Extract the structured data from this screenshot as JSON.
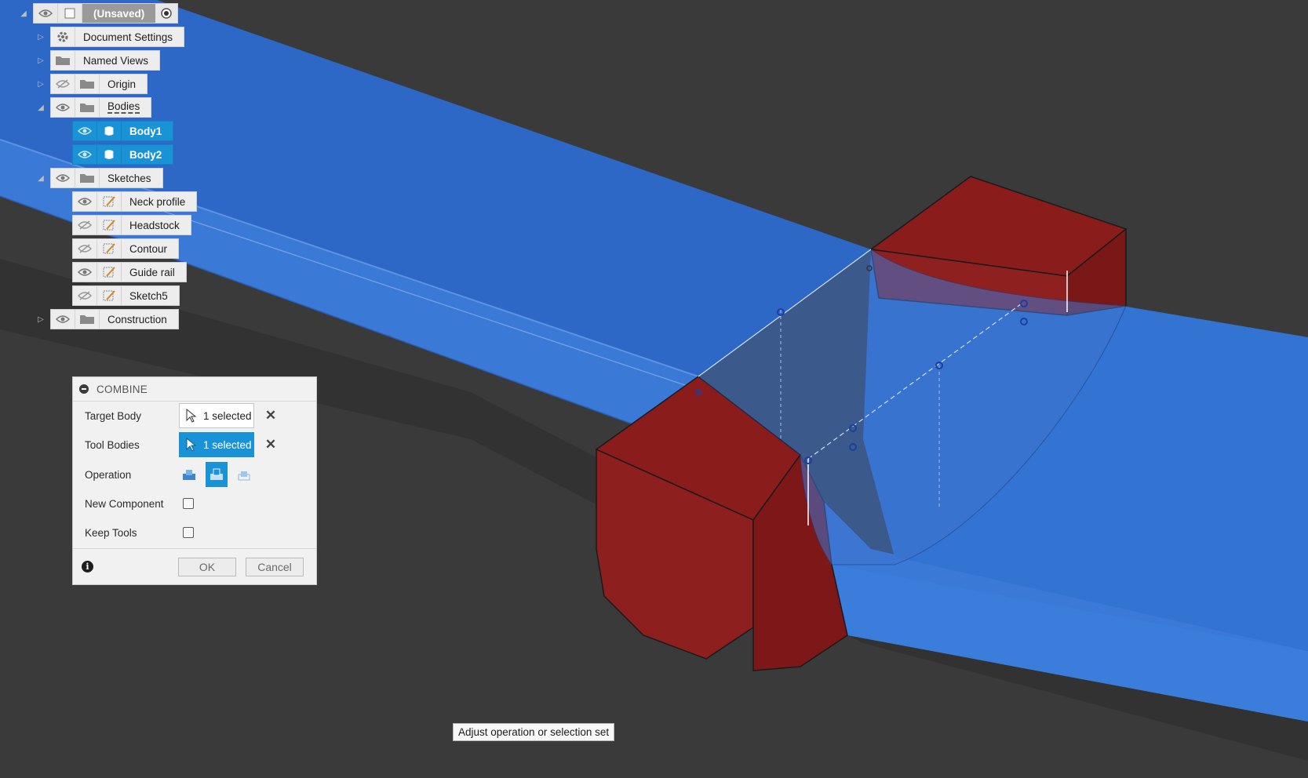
{
  "browser": {
    "root": {
      "label": "(Unsaved)"
    },
    "items": [
      {
        "label": "Document Settings"
      },
      {
        "label": "Named Views"
      },
      {
        "label": "Origin"
      },
      {
        "label": "Bodies"
      },
      {
        "label": "Body1"
      },
      {
        "label": "Body2"
      },
      {
        "label": "Sketches"
      },
      {
        "label": "Neck profile"
      },
      {
        "label": "Headstock"
      },
      {
        "label": "Contour"
      },
      {
        "label": "Guide rail"
      },
      {
        "label": "Sketch5"
      },
      {
        "label": "Construction"
      }
    ]
  },
  "dialog": {
    "title": "COMBINE",
    "target_body": {
      "label": "Target Body",
      "value": "1 selected"
    },
    "tool_bodies": {
      "label": "Tool Bodies",
      "value": "1 selected"
    },
    "operation": {
      "label": "Operation",
      "options": [
        "join",
        "cut",
        "intersect"
      ],
      "selected": "cut"
    },
    "new_component": {
      "label": "New Component",
      "checked": false
    },
    "keep_tools": {
      "label": "Keep Tools",
      "checked": false
    },
    "ok": "OK",
    "cancel": "Cancel"
  },
  "tooltip": "Adjust operation or selection set",
  "colors": {
    "background": "#3a3a3a",
    "body_blue": "#2f6fcf",
    "body_red": "#8b1c1c",
    "selection": "#1a93d6"
  }
}
